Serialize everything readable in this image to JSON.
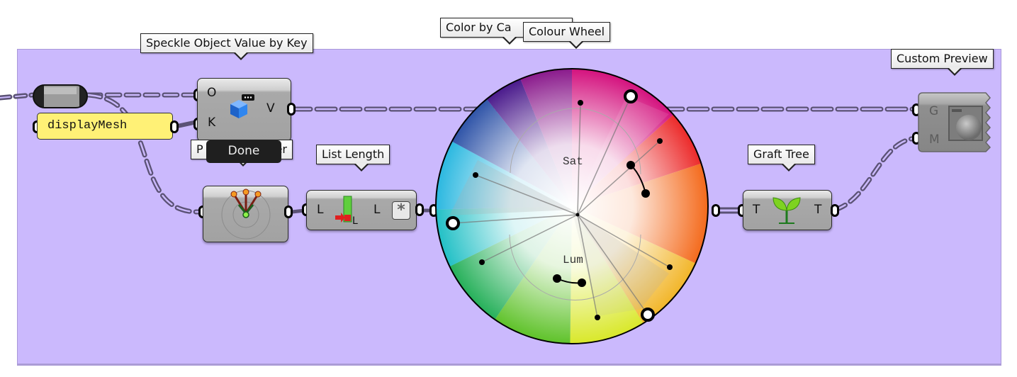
{
  "canvas": {
    "group_color": "#cbb9fd",
    "wire_color": "#5b5275"
  },
  "tooltips": {
    "speckle": "Speckle Object Value by Key",
    "color_by": "Color by Ca",
    "colour_wheel": "Colour Wheel",
    "custom_preview": "Custom Preview",
    "list_length": "List Length",
    "graft_tree": "Graft Tree",
    "param_viewer_start": "P",
    "param_viewer_end": "er"
  },
  "panel": {
    "value": "displayMesh"
  },
  "speckle_component": {
    "inputs": [
      "O",
      "K"
    ],
    "outputs": [
      "V"
    ],
    "status": "Done",
    "icon": "speckle-cube-icon"
  },
  "param_viewer": {
    "icon": "tree-branches-icon"
  },
  "list_length": {
    "inputs": [
      "L"
    ],
    "outputs": [
      "L"
    ],
    "icon": "list-length-icon",
    "option": "*"
  },
  "colour_wheel": {
    "sat_label": "Sat",
    "lum_label": "Lum",
    "colors": {
      "magenta": "#d4127e",
      "red": "#ec2a2a",
      "orange": "#f46a1c",
      "yellow": "#f2e22a",
      "green": "#36b52a",
      "cyan": "#2bc4e0",
      "blue": "#2f54a8",
      "purple": "#5b1a8c"
    }
  },
  "graft_tree": {
    "inputs": [
      "T"
    ],
    "outputs": [
      "T"
    ],
    "icon": "sprout-icon"
  },
  "custom_preview": {
    "inputs": [
      "G",
      "M"
    ],
    "icon": "preview-sphere-icon"
  }
}
